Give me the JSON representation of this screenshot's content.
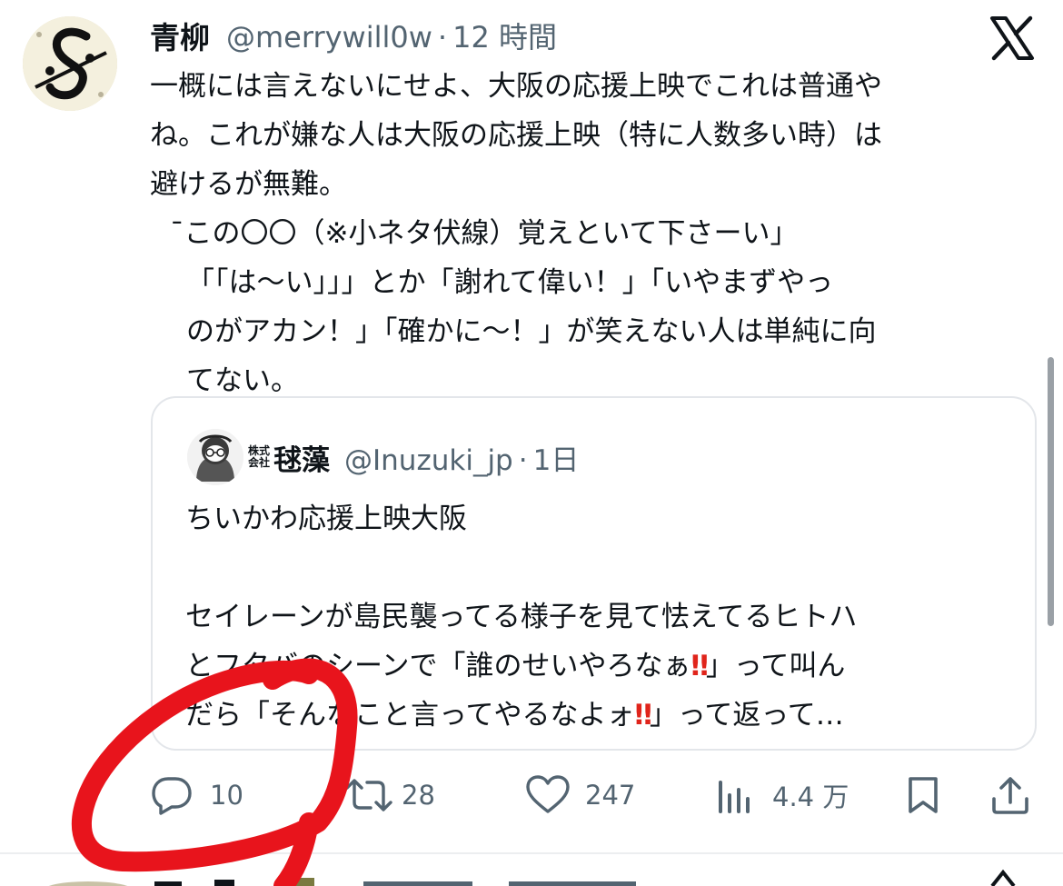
{
  "tweet": {
    "author_name": "青柳",
    "handle": "@merrywill0w",
    "separator": "·",
    "time": "12 時間",
    "lines": [
      "一概には言えないにせよ、大阪の応援上映でこれは普通や",
      "ね。これが嫌な人は大阪の応援上映（特に人数多い時）は",
      "避けるが無難。",
      "¯この〇〇（※小ネタ伏線）覚えといて下さーい」",
      "「「は〜い」」」とか「謝れて偉い！」「いやまずやっ",
      "のがアカン！」「確かに〜！」が笑えない人は単純に向",
      "てない。"
    ]
  },
  "quote": {
    "company_prefix_top": "株式",
    "company_prefix_bottom": "会社",
    "author_name": "毬藻",
    "handle": "@Inuzuki_jp",
    "separator": "·",
    "time": "1日",
    "line1": "ちいかわ応援上映大阪",
    "line2": "",
    "line3": "セイレーンが島民襲ってる様子を見て怯えてるヒトハ",
    "line4_a": "とフタバのシーンで「誰のせいやろなぁ",
    "line4_bang": "‼",
    "line4_b": "」って叫ん",
    "line5_a": "だら「そんなこと言ってやるなよォ",
    "line5_bang": "‼",
    "line5_b": "」って返って…"
  },
  "actions": {
    "reply_count": "10",
    "retweet_count": "28",
    "like_count": "247",
    "views_count": "4.4 万"
  },
  "icons": {
    "reply": "reply-icon",
    "retweet": "retweet-icon",
    "like": "heart-icon",
    "views": "views-chart-icon",
    "bookmark": "bookmark-icon",
    "share": "share-icon",
    "logo": "x-logo-icon"
  },
  "colors": {
    "text": "#0f1419",
    "secondary": "#536471",
    "annotation_red": "#e8141c",
    "exclamation_red": "#e0241b"
  }
}
